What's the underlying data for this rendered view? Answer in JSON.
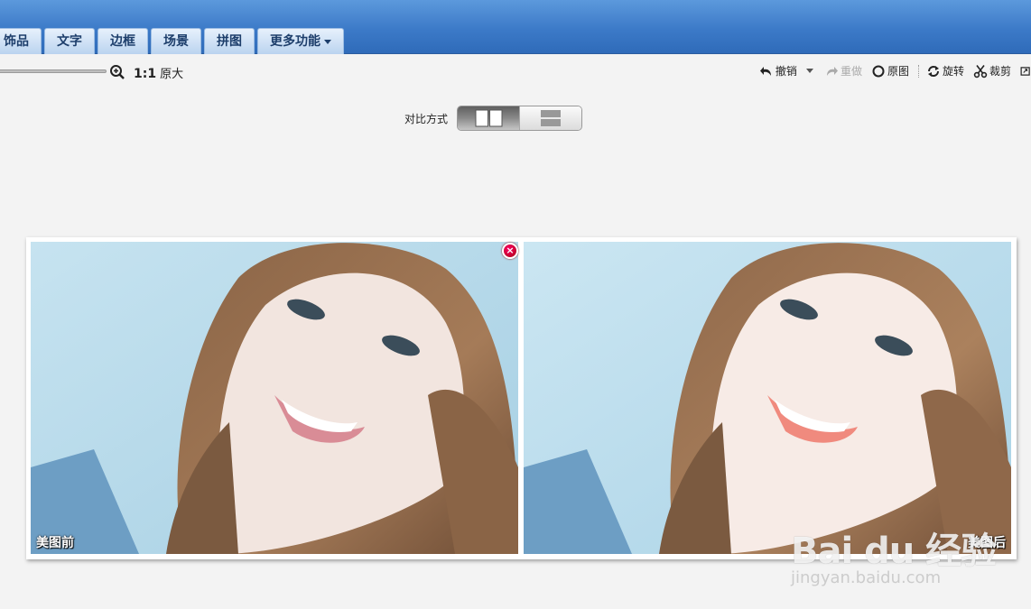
{
  "tabs": [
    "饰品",
    "文字",
    "边框",
    "场景",
    "拼图",
    "更多功能"
  ],
  "toolbar": {
    "actual_size_ratio": "1:1",
    "actual_size_label": "原大",
    "zoom_level": 0.0,
    "tools": {
      "undo": "撤销",
      "redo": "重做",
      "original": "原图",
      "rotate": "旋转",
      "crop": "裁剪"
    }
  },
  "compare": {
    "label": "对比方式",
    "options": [
      "side-by-side",
      "top-bottom"
    ],
    "selected": "side-by-side"
  },
  "photos": {
    "before_label": "美图前",
    "after_label": "美图后",
    "close_icon": "close-icon"
  },
  "watermark": {
    "logo": "Bai du 经验",
    "url": "jingyan.baidu.com"
  },
  "colors": {
    "topbar": "#3c7ac8",
    "tab_bg": "#d3e4f6",
    "close_red": "#d10030",
    "background": "#f3f3f3"
  }
}
